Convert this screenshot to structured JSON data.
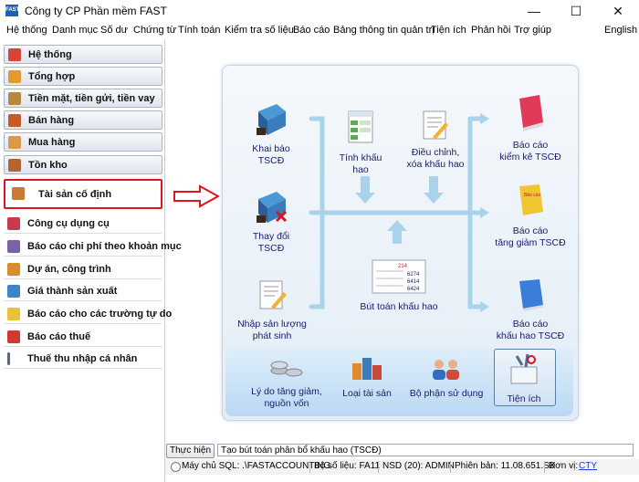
{
  "window": {
    "title": "Công ty CP Phần mềm FAST",
    "app_icon_text": "FAST",
    "minimize": "—",
    "maximize": "☐",
    "close": "✕"
  },
  "menu": [
    "Hệ thống",
    "Danh mục",
    "Số dư",
    "Chứng từ",
    "Tính toán",
    "Kiểm tra số liệu",
    "Báo cáo",
    "Bảng thông tin quản trị",
    "Tiện ích",
    "Phản hồi",
    "Trợ giúp",
    "English"
  ],
  "sidebar": {
    "items": [
      {
        "label": "Hệ thống",
        "color": "#d8433a"
      },
      {
        "label": "Tổng hợp",
        "color": "#e39b2f"
      },
      {
        "label": "Tiền mặt, tiền gửi, tiền vay",
        "color": "#b6893f"
      },
      {
        "label": "Bán hàng",
        "color": "#c55a2a"
      },
      {
        "label": "Mua hàng",
        "color": "#d89a4a"
      },
      {
        "label": "Tồn kho",
        "color": "#b5652f"
      },
      {
        "label": "Tài sản cố định",
        "color": "#c77b33"
      },
      {
        "label": "Công cụ dụng cụ",
        "color": "#c83a4c"
      },
      {
        "label": "Báo cáo chi phí theo khoản mục",
        "color": "#7a62a8"
      },
      {
        "label": "Dự án, công trình",
        "color": "#d98d2c"
      },
      {
        "label": "Giá thành sản xuất",
        "color": "#3f84c8"
      },
      {
        "label": "Báo cáo cho các trường tự do",
        "color": "#e8c23b"
      },
      {
        "label": "Báo cáo thuế",
        "color": "#cf3a33"
      },
      {
        "label": "Thuế thu nhập cá nhân",
        "color": "#5a6a7a"
      }
    ]
  },
  "diagram": {
    "khai_bao": "Khai báo TSCĐ",
    "thay_doi": "Thay đổi TSCĐ",
    "nhap_san_luong_1": "Nhập sản lượng",
    "nhap_san_luong_2": "phát sinh",
    "tinh_khau_hao": "Tính khấu hao",
    "dieu_chinh_1": "Điều chỉnh,",
    "dieu_chinh_2": "xóa khấu hao",
    "but_toan": "Bút toán khấu hao",
    "bc_kiem_ke_1": "Báo cáo",
    "bc_kiem_ke_2": "kiểm kê TSCĐ",
    "bc_tang_giam_1": "Báo cáo",
    "bc_tang_giam_2": "tăng giảm TSCĐ",
    "bc_khau_hao_1": "Báo cáo",
    "bc_khau_hao_2": "khấu hao TSCĐ",
    "ly_do_1": "Lý do tăng giảm,",
    "ly_do_2": "nguồn vốn",
    "loai_tai_san": "Loại tài sản",
    "bo_phan": "Bộ phận sử dụng",
    "tien_ich": "Tiện ích",
    "ledger_214": "214",
    "ledger_6274": "6274",
    "ledger_6414": "6414",
    "ledger_6424": "6424",
    "report_tag": "Báo cáo"
  },
  "command": {
    "button": "Thực hiện",
    "text": "Tạo bút toán phân bổ khấu hao (TSCĐ)"
  },
  "status": {
    "server": "Máy chủ SQL: .\\FASTACCOUNTING",
    "db": "Bộ số liệu: FA11",
    "user": "NSD (20): ADMIN",
    "version": "Phiên bản: 11.08.651.SX",
    "unit_label": "Đơn vị:",
    "unit": "CTY"
  },
  "colors": {
    "active_border": "#e0141c",
    "arrow": "#e0141c",
    "panel_text": "#1a1a70"
  }
}
